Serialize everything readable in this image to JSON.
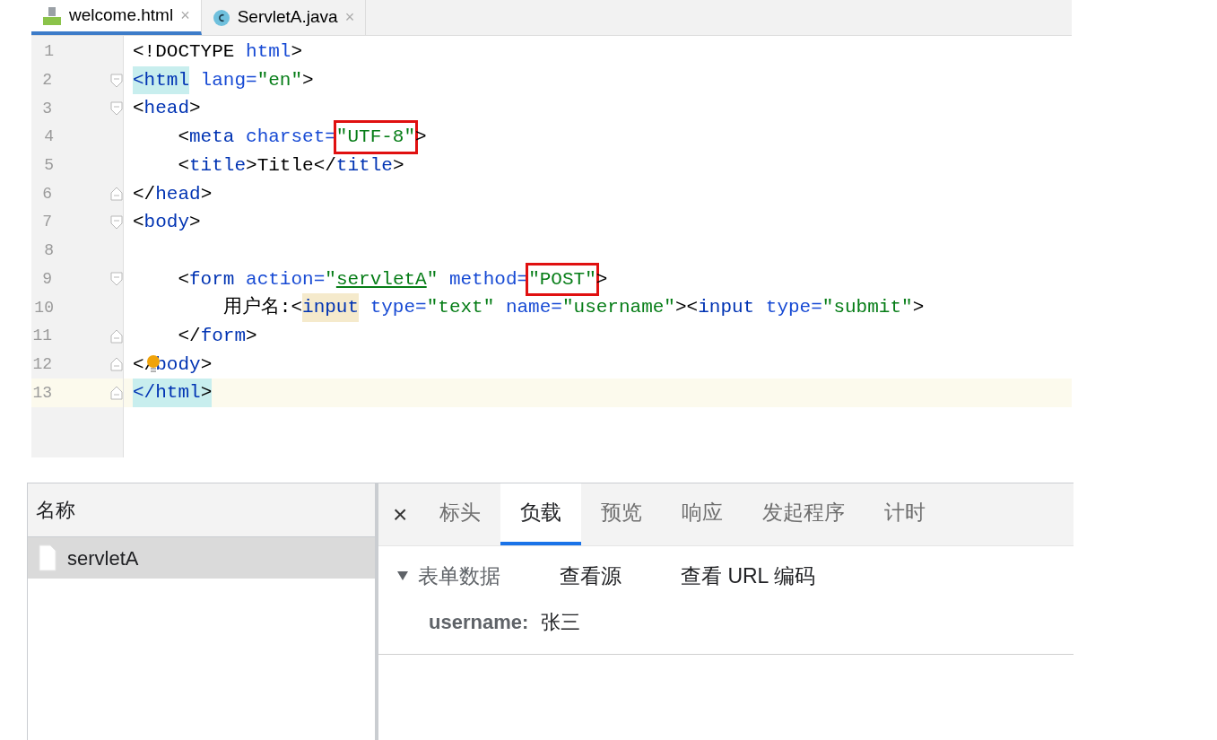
{
  "editor_tabs": [
    {
      "label": "welcome.html",
      "kind": "html",
      "selected": true,
      "close": "×"
    },
    {
      "label": "ServletA.java",
      "kind": "java",
      "selected": false,
      "close": "×"
    }
  ],
  "code_lines": [
    {
      "number": "1",
      "fold_start": false,
      "fold_end": false,
      "current": false,
      "tokens": [
        {
          "text": "<!DOCTYPE ",
          "kind": "punct"
        },
        {
          "text": "html",
          "kind": "attr"
        },
        {
          "text": ">",
          "kind": "punct"
        }
      ]
    },
    {
      "number": "2",
      "fold_start": true,
      "fold_end": false,
      "current": false,
      "tokens": [
        {
          "text": "<html",
          "kind": "tag",
          "matched": true
        },
        {
          "text": " lang=",
          "kind": "attr"
        },
        {
          "text": "\"en\"",
          "kind": "value"
        },
        {
          "text": ">",
          "kind": "punct"
        }
      ]
    },
    {
      "number": "3",
      "fold_start": true,
      "fold_end": false,
      "current": false,
      "tokens": [
        {
          "text": "<",
          "kind": "punct"
        },
        {
          "text": "head",
          "kind": "tag"
        },
        {
          "text": ">",
          "kind": "punct"
        }
      ]
    },
    {
      "number": "4",
      "fold_start": false,
      "fold_end": false,
      "current": false,
      "tokens": [
        {
          "text": "    <",
          "kind": "punct"
        },
        {
          "text": "meta",
          "kind": "tag"
        },
        {
          "text": " charset=",
          "kind": "attr"
        },
        {
          "text": "\"UTF-8\"",
          "kind": "value",
          "boxed": true
        },
        {
          "text": ">",
          "kind": "punct"
        }
      ]
    },
    {
      "number": "5",
      "fold_start": false,
      "fold_end": false,
      "current": false,
      "tokens": [
        {
          "text": "    <",
          "kind": "punct"
        },
        {
          "text": "title",
          "kind": "tag"
        },
        {
          "text": ">Title</",
          "kind": "punct"
        },
        {
          "text": "title",
          "kind": "tag"
        },
        {
          "text": ">",
          "kind": "punct"
        }
      ]
    },
    {
      "number": "6",
      "fold_start": false,
      "fold_end": true,
      "current": false,
      "tokens": [
        {
          "text": "</",
          "kind": "punct"
        },
        {
          "text": "head",
          "kind": "tag"
        },
        {
          "text": ">",
          "kind": "punct"
        }
      ]
    },
    {
      "number": "7",
      "fold_start": true,
      "fold_end": false,
      "current": false,
      "tokens": [
        {
          "text": "<",
          "kind": "punct"
        },
        {
          "text": "body",
          "kind": "tag"
        },
        {
          "text": ">",
          "kind": "punct"
        }
      ]
    },
    {
      "number": "8",
      "fold_start": false,
      "fold_end": false,
      "current": false
    },
    {
      "number": "9",
      "fold_start": true,
      "fold_end": false,
      "current": false,
      "tokens": [
        {
          "text": "    <",
          "kind": "punct"
        },
        {
          "text": "form",
          "kind": "tag"
        },
        {
          "text": " action=",
          "kind": "attr"
        },
        {
          "text": "\"",
          "kind": "value"
        },
        {
          "text": "servletA",
          "kind": "value",
          "underlined": true
        },
        {
          "text": "\"",
          "kind": "value"
        },
        {
          "text": " method=",
          "kind": "attr"
        },
        {
          "text": "\"POST\"",
          "kind": "value",
          "boxed": true
        },
        {
          "text": ">",
          "kind": "punct"
        }
      ]
    },
    {
      "number": "10",
      "fold_start": false,
      "fold_end": false,
      "current": false,
      "tokens": [
        {
          "text": "        用户名:<",
          "kind": "punct"
        },
        {
          "text": "input",
          "kind": "tag",
          "hinted": true
        },
        {
          "text": " type=",
          "kind": "attr"
        },
        {
          "text": "\"text\"",
          "kind": "value"
        },
        {
          "text": " name=",
          "kind": "attr"
        },
        {
          "text": "\"username\"",
          "kind": "value"
        },
        {
          "text": "><",
          "kind": "punct"
        },
        {
          "text": "input",
          "kind": "tag"
        },
        {
          "text": " type=",
          "kind": "attr"
        },
        {
          "text": "\"submit\"",
          "kind": "value"
        },
        {
          "text": ">",
          "kind": "punct"
        }
      ]
    },
    {
      "number": "11",
      "fold_start": false,
      "fold_end": true,
      "current": false,
      "tokens": [
        {
          "text": "    </",
          "kind": "punct"
        },
        {
          "text": "form",
          "kind": "tag"
        },
        {
          "text": ">",
          "kind": "punct"
        }
      ]
    },
    {
      "number": "12",
      "fold_start": false,
      "fold_end": true,
      "current": false,
      "bulb": true,
      "tokens": [
        {
          "text": "</",
          "kind": "punct"
        },
        {
          "text": "body",
          "kind": "tag"
        },
        {
          "text": ">",
          "kind": "punct"
        }
      ]
    },
    {
      "number": "13",
      "fold_start": false,
      "fold_end": true,
      "current": true,
      "tokens": [
        {
          "text": "</html",
          "kind": "tag",
          "matched": true
        },
        {
          "text": ">",
          "kind": "punct",
          "matched": true
        }
      ]
    }
  ],
  "requests": {
    "header": "名称",
    "items": [
      {
        "name": "servletA",
        "selected": true
      }
    ]
  },
  "detail_tabs": {
    "close": "×",
    "tabs": [
      {
        "label": "标头",
        "selected": false
      },
      {
        "label": "负载",
        "selected": true
      },
      {
        "label": "预览",
        "selected": false
      },
      {
        "label": "响应",
        "selected": false
      },
      {
        "label": "发起程序",
        "selected": false
      },
      {
        "label": "计时",
        "selected": false
      }
    ]
  },
  "form_data": {
    "title": "表单数据",
    "expanded": true,
    "actions": [
      "查看源",
      "查看 URL 编码"
    ],
    "fields": [
      {
        "key": "username:",
        "value": "张三"
      }
    ]
  }
}
